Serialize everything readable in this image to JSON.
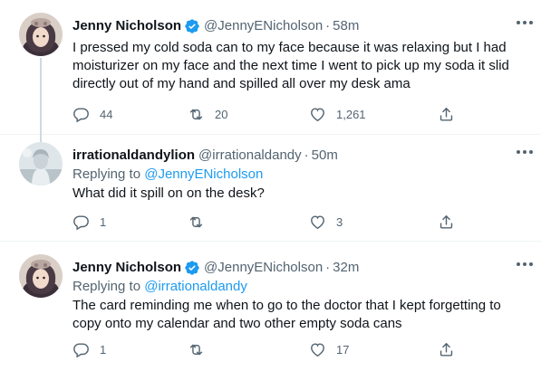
{
  "tweets": [
    {
      "name": "Jenny Nicholson",
      "handle": "@JennyENicholson",
      "separator": "·",
      "time": "58m",
      "reply_prefix": "",
      "reply_handle": "",
      "text": "I pressed my cold soda can to my face because it was relaxing but I had moisturizer on my face and the next time I went to pick up my soda it slid directly out of my hand and spilled all over my desk ama",
      "replies": "44",
      "retweets": "20",
      "likes": "1,261",
      "verified": true
    },
    {
      "name": "irrationaldandylion",
      "handle": "@irrationaldandy",
      "separator": "·",
      "time": "50m",
      "reply_prefix": "Replying to ",
      "reply_handle": "@JennyENicholson",
      "text": "What did it spill on on the desk?",
      "replies": "1",
      "retweets": "",
      "likes": "3",
      "verified": false
    },
    {
      "name": "Jenny Nicholson",
      "handle": "@JennyENicholson",
      "separator": "·",
      "time": "32m",
      "reply_prefix": "Replying to ",
      "reply_handle": "@irrationaldandy",
      "text": "The card reminding me when to go to the doctor that I kept forgetting to copy onto my calendar and two other empty soda cans",
      "replies": "1",
      "retweets": "",
      "likes": "17",
      "verified": true
    }
  ],
  "colors": {
    "accent": "#1d9bf0",
    "text": "#0f1419",
    "secondary": "#536471",
    "divider": "#eff3f4"
  },
  "icons": [
    "verified-badge-icon",
    "more-icon",
    "reply-icon",
    "retweet-icon",
    "like-icon",
    "share-icon"
  ]
}
